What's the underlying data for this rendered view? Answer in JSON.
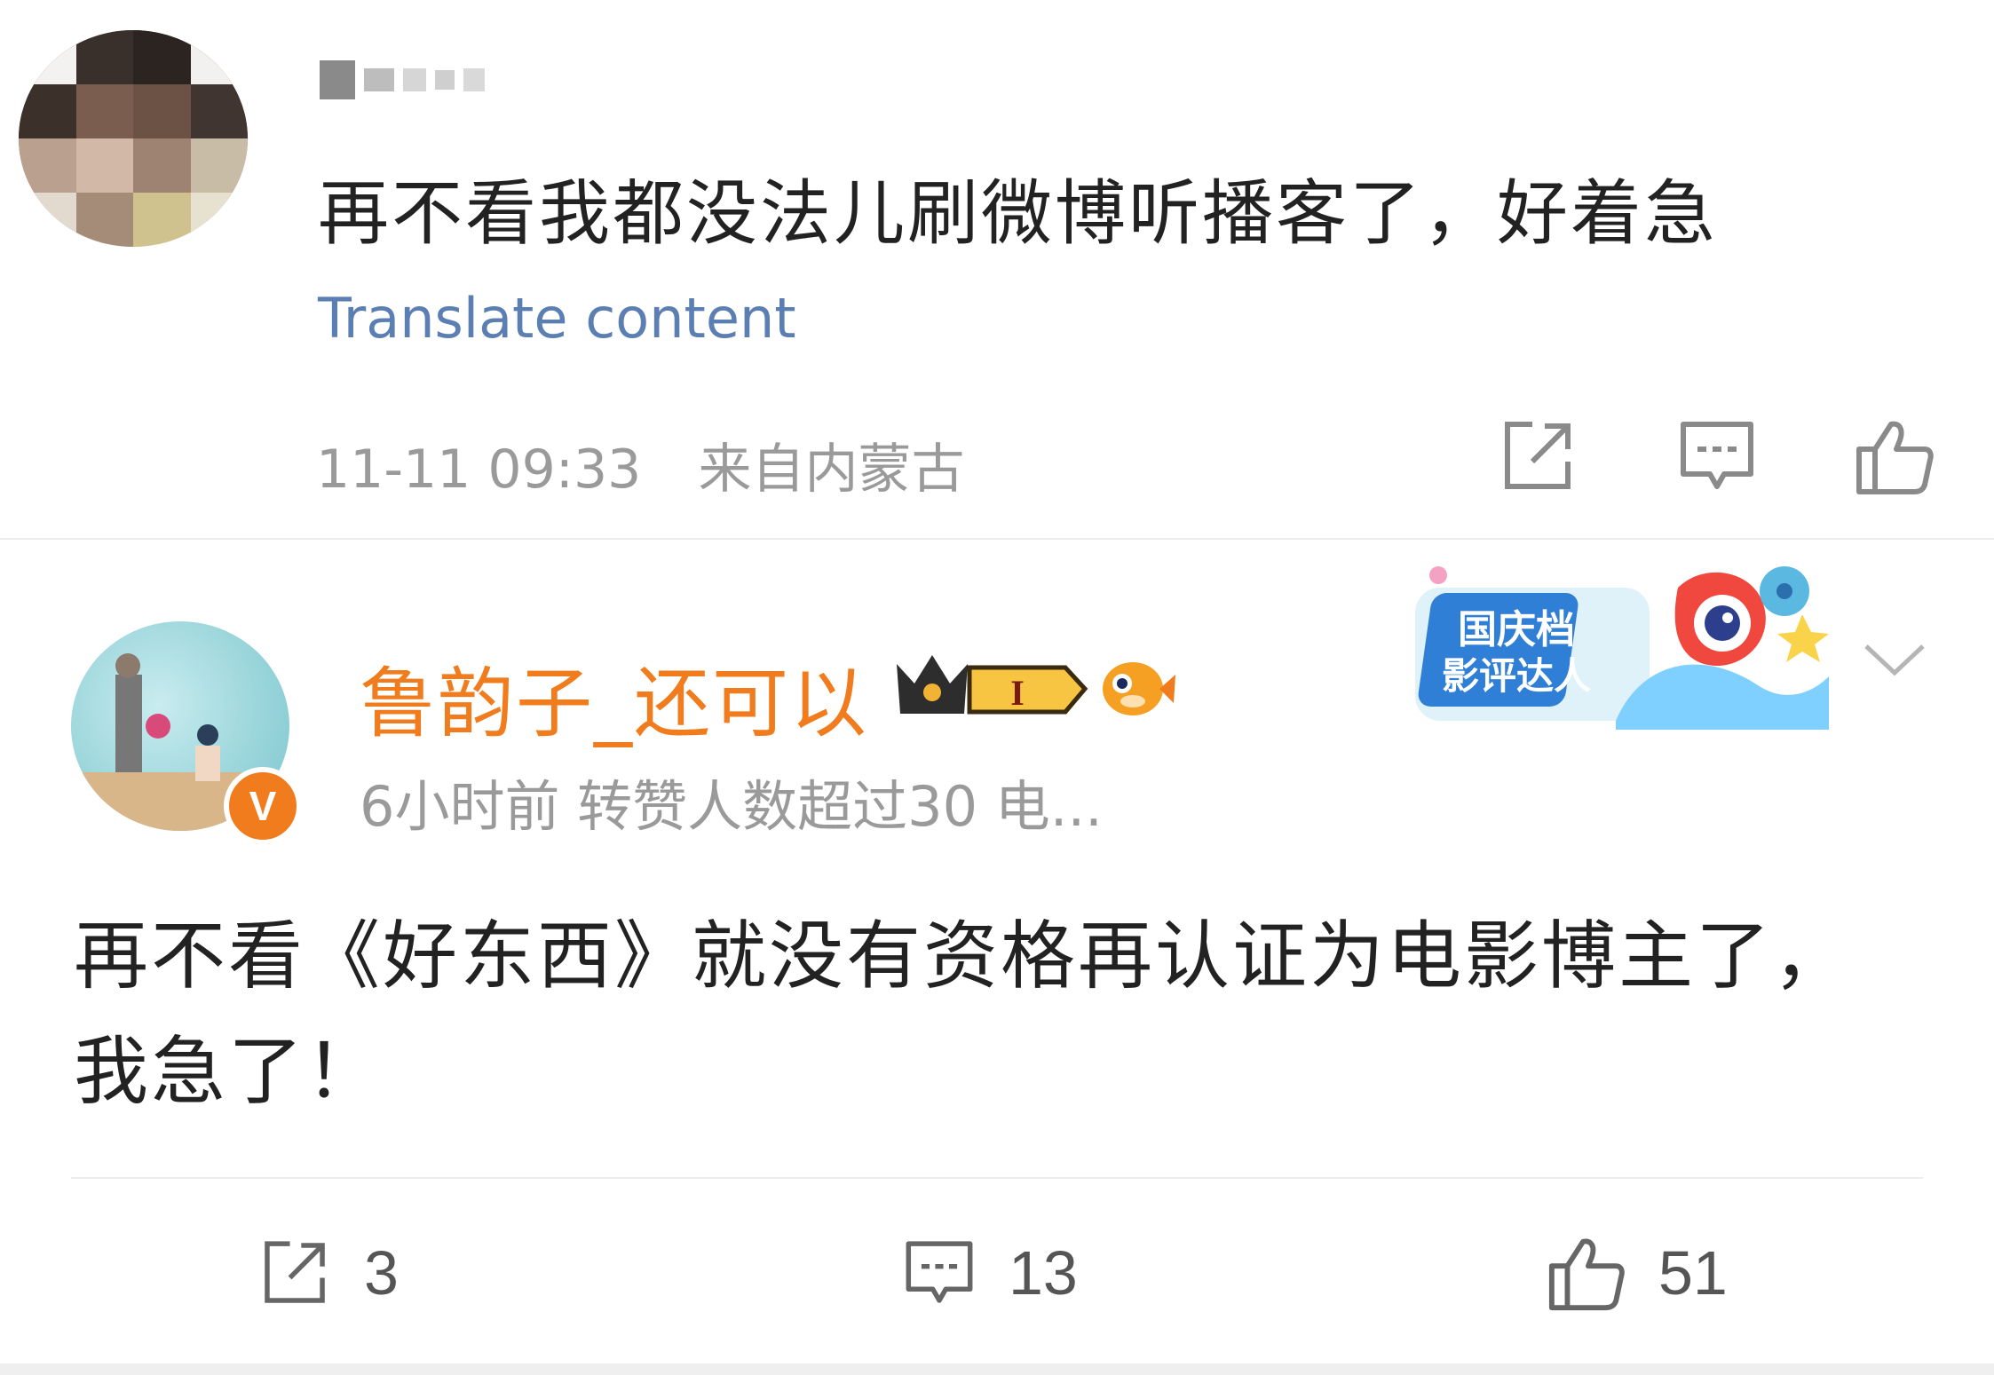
{
  "comment": {
    "text": "再不看我都没法儿刷微博听播客了，好着急",
    "translate_label": "Translate content",
    "timestamp": "11-11 09:33",
    "source": "来自内蒙古",
    "icons": [
      "share-icon",
      "comment-icon",
      "like-icon"
    ]
  },
  "post": {
    "username": "鲁韵子_还可以",
    "level_badge": "I",
    "verified_badge": "V",
    "meta": "6小时前 转赞人数超过30  电...",
    "event_badge": {
      "line1": "国庆档",
      "line2": "影评达人"
    },
    "text": "再不看《好东西》就没有资格再认证为电影博主了，我急了！",
    "actions": {
      "repost_count": "3",
      "comment_count": "13",
      "like_count": "51"
    }
  },
  "colors": {
    "username": "#f07c1e",
    "link": "#5b7fb2",
    "meta": "#9a9a9a",
    "text": "#222222"
  }
}
